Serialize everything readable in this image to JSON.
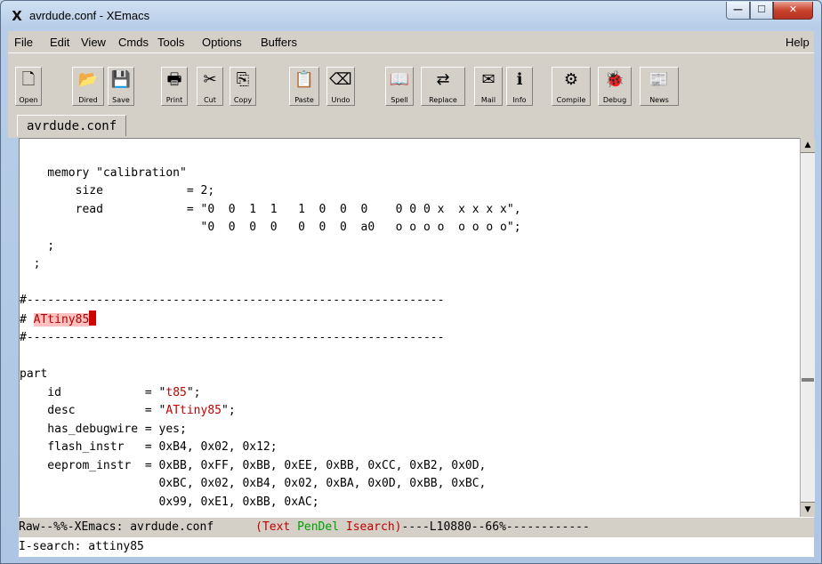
{
  "window": {
    "title": "avrdude.conf - XEmacs",
    "app_icon": "xemacs-icon",
    "controls": {
      "minimize": "—",
      "maximize": "☐",
      "close": "✕"
    }
  },
  "menubar": {
    "items": [
      {
        "label": "File"
      },
      {
        "label": "Edit"
      },
      {
        "label": "View"
      },
      {
        "label": "Cmds"
      },
      {
        "label": "Tools"
      },
      {
        "label": "Options"
      },
      {
        "label": "Buffers"
      }
    ],
    "help": "Help"
  },
  "toolbar": {
    "buttons": [
      {
        "label": "Open",
        "icon": "open-file-icon",
        "glyph": "🗋"
      },
      {
        "label": "Dired",
        "icon": "folder-icon",
        "glyph": "📂"
      },
      {
        "label": "Save",
        "icon": "save-icon",
        "glyph": "💾"
      },
      {
        "label": "Print",
        "icon": "printer-icon",
        "glyph": "🖶"
      },
      {
        "label": "Cut",
        "icon": "scissors-icon",
        "glyph": "✂"
      },
      {
        "label": "Copy",
        "icon": "copy-icon",
        "glyph": "⎘"
      },
      {
        "label": "Paste",
        "icon": "paste-icon",
        "glyph": "📋"
      },
      {
        "label": "Undo",
        "icon": "eraser-icon",
        "glyph": "⌫"
      },
      {
        "label": "Spell",
        "icon": "book-icon",
        "glyph": "📖"
      },
      {
        "label": "Replace",
        "icon": "replace-icon",
        "glyph": "⇄"
      },
      {
        "label": "Mail",
        "icon": "mail-icon",
        "glyph": "✉"
      },
      {
        "label": "Info",
        "icon": "info-icon",
        "glyph": "ℹ"
      },
      {
        "label": "Compile",
        "icon": "gear-icon",
        "glyph": "⚙"
      },
      {
        "label": "Debug",
        "icon": "bug-icon",
        "glyph": "🐞"
      },
      {
        "label": "News",
        "icon": "news-icon",
        "glyph": "📰"
      }
    ]
  },
  "tab": {
    "label": "avrdude.conf"
  },
  "editor": {
    "lines": [
      "",
      "    memory \"calibration\"",
      "        size            = 2;",
      "        read            = \"0  0  1  1   1  0  0  0    0 0 0 x  x x x x\",",
      "                          \"0  0  0  0   0  0  0  a0   o o o o  o o o o\";",
      "    ;",
      "  ;",
      "",
      "#------------------------------------------------------------",
      "# ATtiny85",
      "#------------------------------------------------------------",
      "",
      "part",
      "    id            = \"t85\";",
      "    desc          = \"ATtiny85\";",
      "    has_debugwire = yes;",
      "    flash_instr   = 0xB4, 0x02, 0x12;",
      "    eeprom_instr  = 0xBB, 0xFF, 0xBB, 0xEE, 0xBB, 0xCC, 0xB2, 0x0D,",
      "                    0xBC, 0x02, 0xB4, 0x02, 0xBA, 0x0D, 0xBB, 0xBC,",
      "                    0x99, 0xE1, 0xBB, 0xAC;"
    ]
  },
  "modeline": {
    "prefix": "Raw--%%-XEmacs: avrdude.conf      ",
    "open": "(",
    "mode": "Text",
    "pendel": "PenDel",
    "isearch": "Isearch",
    "close": ")",
    "position": "----L10880--66%",
    "fill": "------------"
  },
  "minibuffer": {
    "text": "I-search: attiny85"
  }
}
